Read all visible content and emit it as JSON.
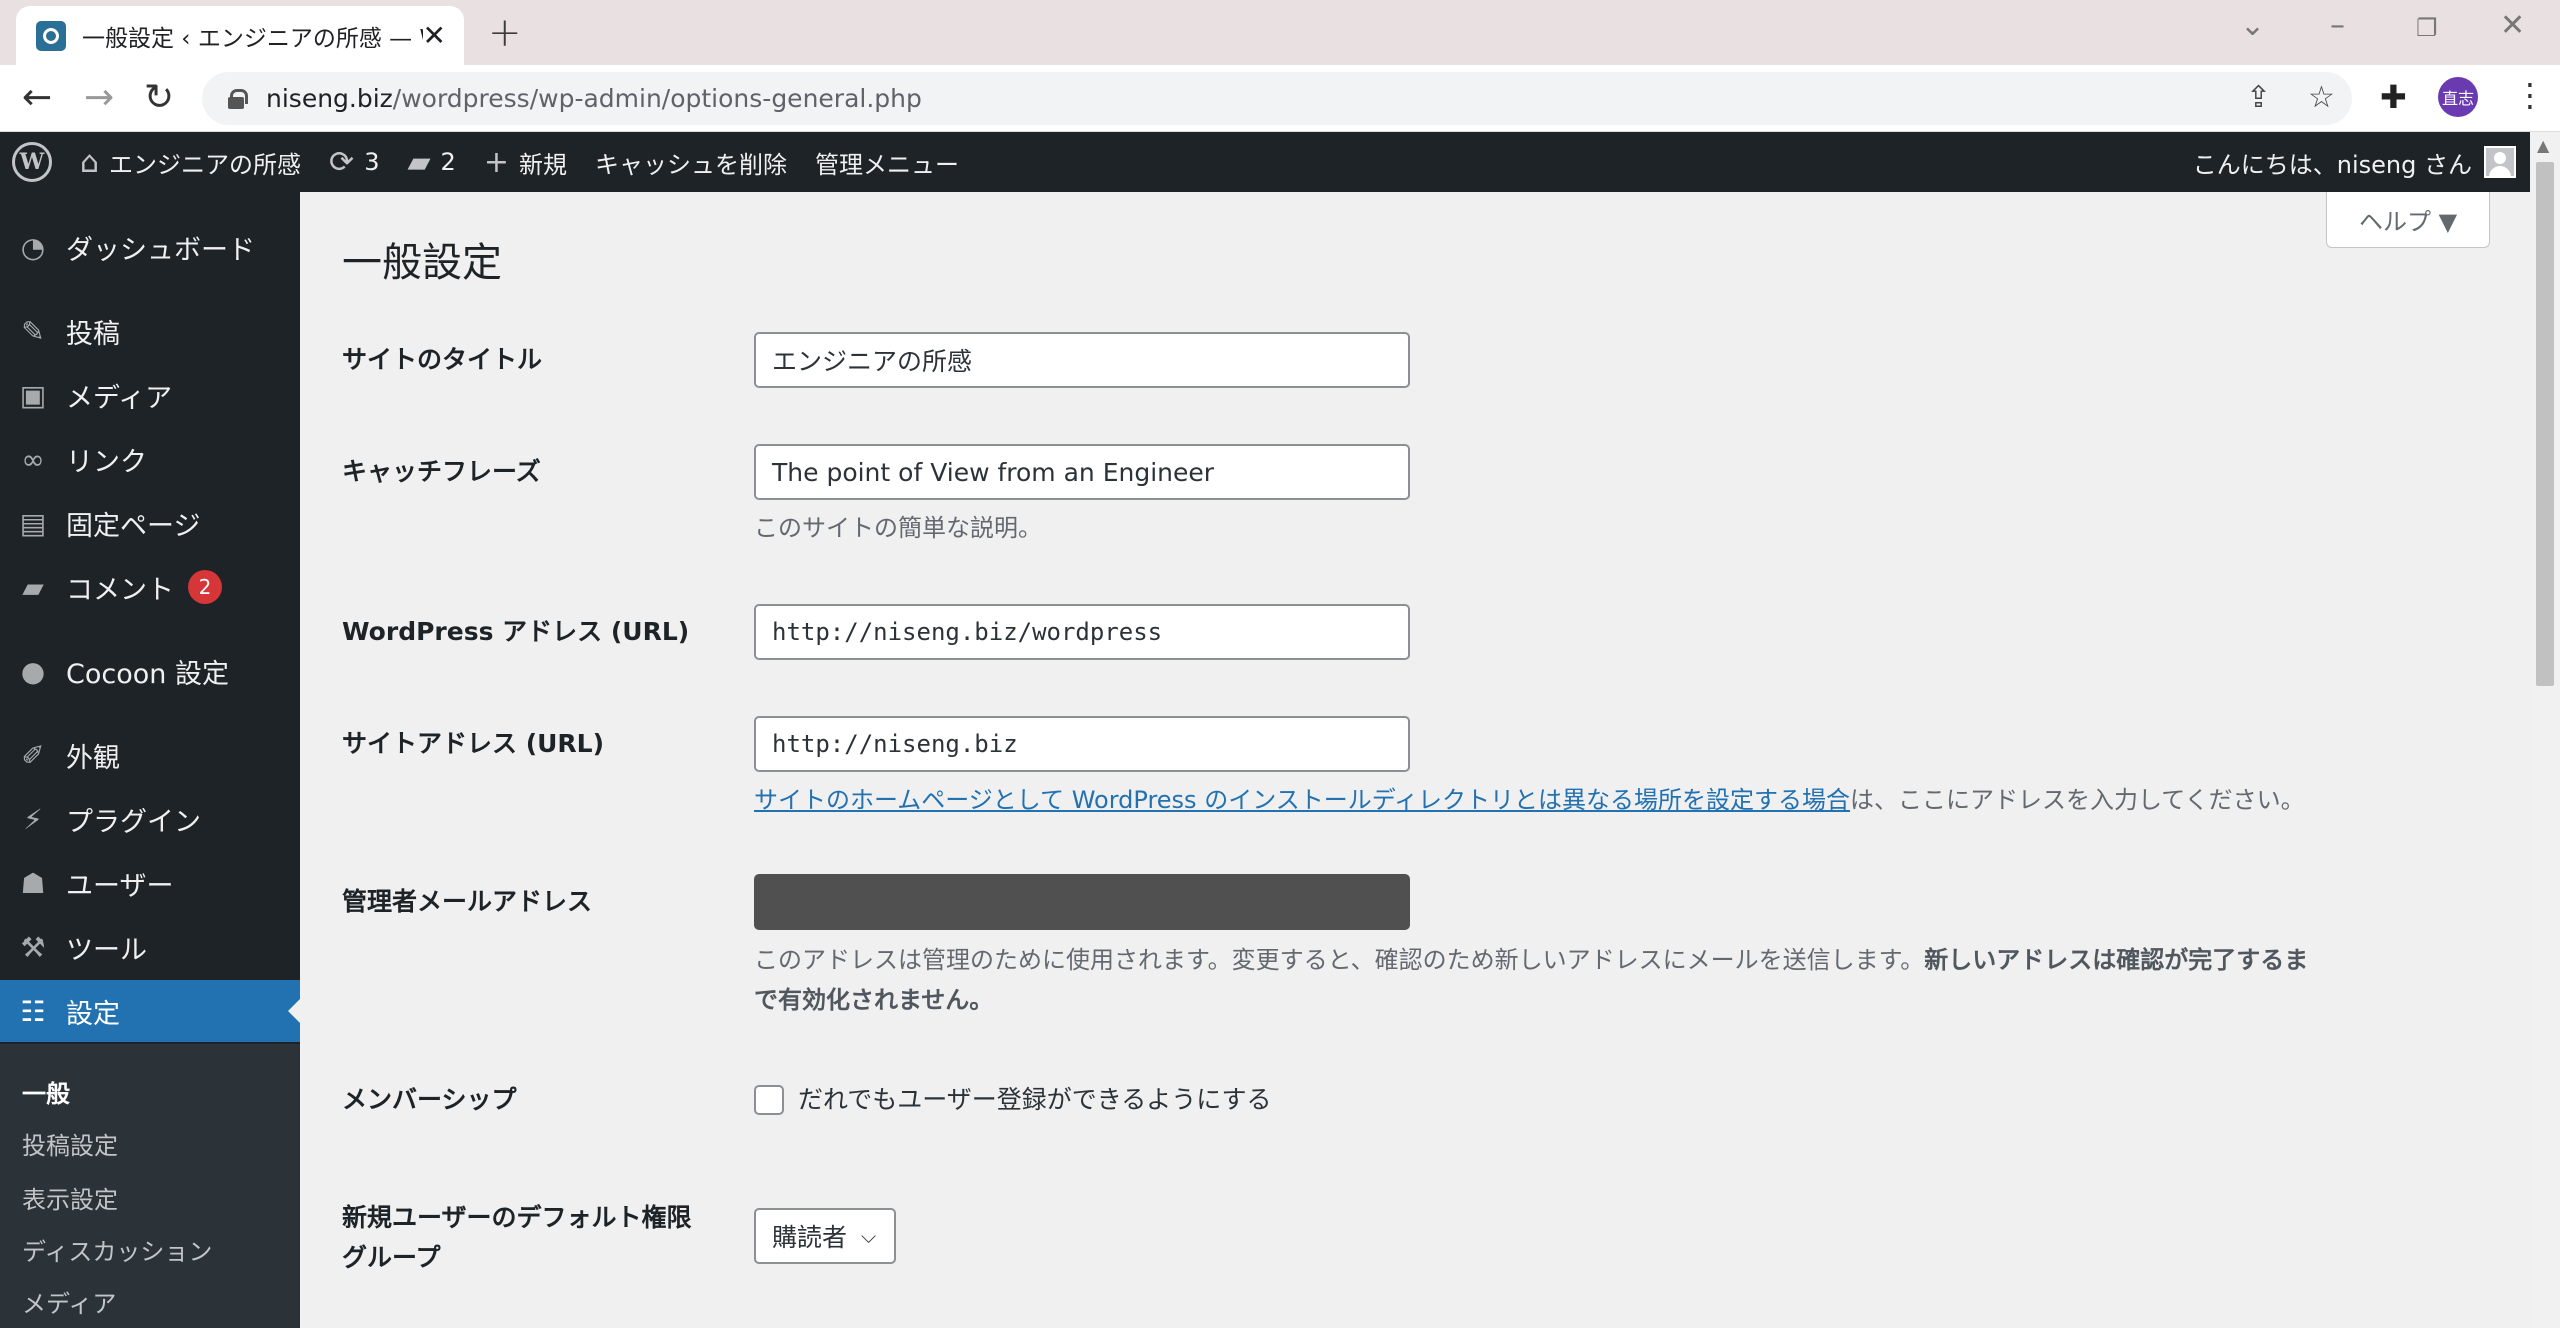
{
  "browser": {
    "tab_title": "一般設定 ‹ エンジニアの所感 — WordPress",
    "url_host": "niseng.biz",
    "url_path": "/wordpress/wp-admin/options-general.php",
    "profile_initials": "直志"
  },
  "adminbar": {
    "site_name": "エンジニアの所感",
    "updates_count": "3",
    "comments_count": "2",
    "new_label": "新規",
    "cache_label": "キャッシュを削除",
    "admin_menu_label": "管理メニュー",
    "greeting": "こんにちは、niseng さん"
  },
  "sidebar": {
    "items": [
      {
        "label": "ダッシュボード",
        "icon": "dashboard-icon"
      },
      {
        "label": "投稿",
        "icon": "pin-icon"
      },
      {
        "label": "メディア",
        "icon": "media-icon"
      },
      {
        "label": "リンク",
        "icon": "link-icon"
      },
      {
        "label": "固定ページ",
        "icon": "page-icon"
      },
      {
        "label": "コメント",
        "icon": "comment-icon",
        "badge": "2"
      },
      {
        "label": "Cocoon 設定",
        "icon": "cocoon-icon"
      },
      {
        "label": "外観",
        "icon": "brush-icon"
      },
      {
        "label": "プラグイン",
        "icon": "plugin-icon"
      },
      {
        "label": "ユーザー",
        "icon": "user-icon"
      },
      {
        "label": "ツール",
        "icon": "wrench-icon"
      },
      {
        "label": "設定",
        "icon": "settings-icon"
      }
    ],
    "submenu": [
      "一般",
      "投稿設定",
      "表示設定",
      "ディスカッション",
      "メディア"
    ]
  },
  "main": {
    "help_label": "ヘルプ ▼",
    "page_title": "一般設定",
    "site_title_label": "サイトのタイトル",
    "site_title_value": "エンジニアの所感",
    "tagline_label": "キャッチフレーズ",
    "tagline_value": "The point of View from an Engineer",
    "tagline_desc": "このサイトの簡単な説明。",
    "wp_address_label": "WordPress アドレス (URL)",
    "wp_address_value": "http://niseng.biz/wordpress",
    "site_address_label": "サイトアドレス (URL)",
    "site_address_value": "http://niseng.biz",
    "site_address_link": "サイトのホームページとして WordPress のインストールディレクトリとは異なる場所を設定する場合",
    "site_address_desc_tail": "は、ここにアドレスを入力してください。",
    "admin_email_label": "管理者メールアドレス",
    "admin_email_desc": "このアドレスは管理のために使用されます。変更すると、確認のため新しいアドレスにメールを送信します。",
    "admin_email_desc_bold_1": "新しいアドレスは確認が完了するま",
    "admin_email_desc_bold_2": "で有効化されません。",
    "membership_label": "メンバーシップ",
    "membership_checkbox_label": "だれでもユーザー登録ができるようにする",
    "default_role_label_1": "新規ユーザーのデフォルト権限",
    "default_role_label_2": "グループ",
    "default_role_value": "購読者"
  }
}
